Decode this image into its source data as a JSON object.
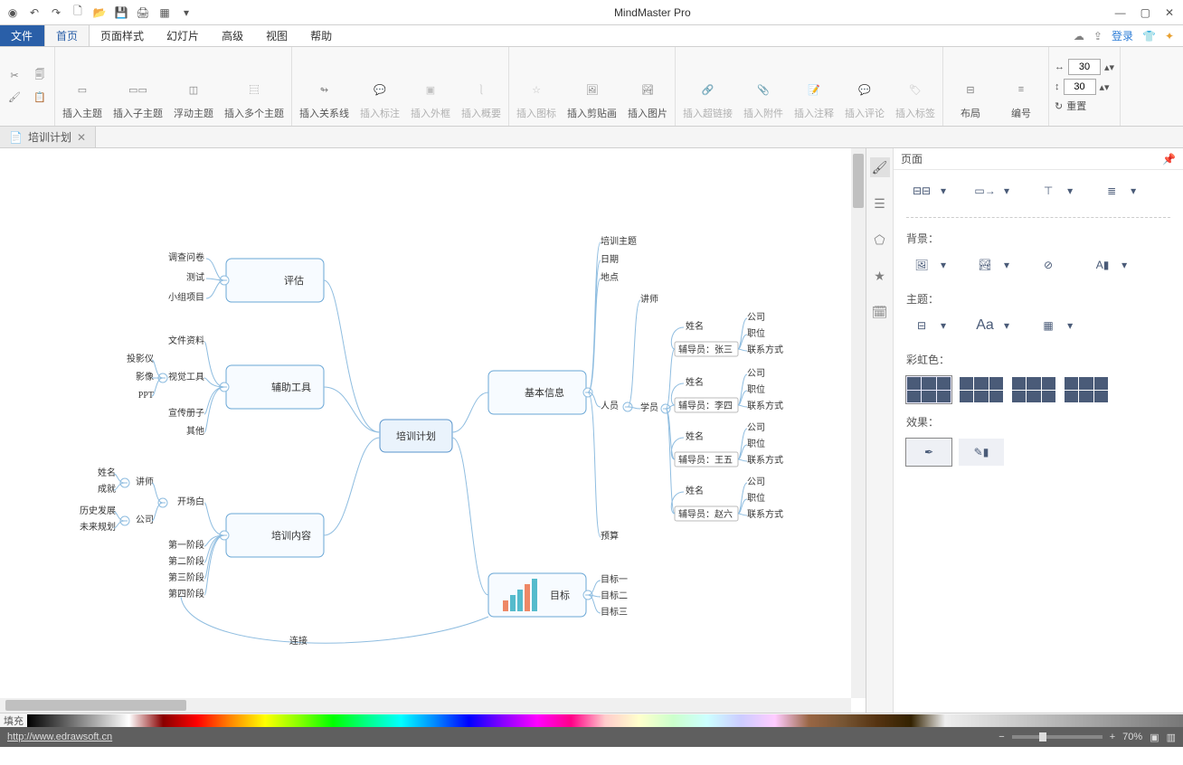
{
  "app": {
    "title": "MindMaster Pro"
  },
  "qat": [
    "target",
    "undo",
    "redo",
    "new",
    "open",
    "save",
    "print",
    "export"
  ],
  "tabs": {
    "file": "文件",
    "items": [
      "首页",
      "页面样式",
      "幻灯片",
      "高级",
      "视图",
      "帮助"
    ],
    "active": 0,
    "login": "登录"
  },
  "ribbon": {
    "insert": [
      "插入主题",
      "插入子主题",
      "浮动主题",
      "插入多个主题"
    ],
    "relation": "插入关系线",
    "dim1": [
      "插入标注",
      "插入外框",
      "插入概要"
    ],
    "dim2": [
      "插入图标"
    ],
    "media": [
      "插入剪贴画",
      "插入图片"
    ],
    "dim3": [
      "插入超链接",
      "插入附件",
      "插入注释",
      "插入评论",
      "插入标签"
    ],
    "layout": "布局",
    "number": "编号",
    "spin1": "30",
    "spin2": "30",
    "reset": "重置"
  },
  "doc_tab": {
    "name": "培训计划"
  },
  "side_panel": {
    "title": "页面",
    "sections": {
      "bg": "背景：",
      "theme": "主题：",
      "rainbow": "彩虹色：",
      "effect": "效果："
    }
  },
  "status": {
    "fill": "填充",
    "url": "http://www.edrawsoft.cn",
    "zoom": "70%"
  },
  "mindmap": {
    "root": "培训计划",
    "left": [
      {
        "label": "评估",
        "children": [
          "调查问卷",
          "测试",
          "小组项目"
        ]
      },
      {
        "label": "辅助工具",
        "children": [
          {
            "label": "文件资料"
          },
          {
            "label": "视觉工具",
            "children": [
              "投影仪",
              "影像",
              "PPT"
            ]
          },
          {
            "label": "宣传册子"
          },
          {
            "label": "其他"
          }
        ]
      },
      {
        "label": "培训内容",
        "children": [
          {
            "label": "开场白",
            "children": [
              {
                "label": "讲师",
                "children": [
                  "姓名",
                  "成就"
                ]
              },
              {
                "label": "公司",
                "children": [
                  "历史发展",
                  "未来规划"
                ]
              }
            ]
          },
          {
            "label": "第一阶段"
          },
          {
            "label": "第二阶段"
          },
          {
            "label": "第三阶段"
          },
          {
            "label": "第四阶段"
          }
        ]
      }
    ],
    "right": [
      {
        "label": "基本信息",
        "children": [
          {
            "label": "培训主题"
          },
          {
            "label": "日期"
          },
          {
            "label": "地点"
          },
          {
            "label": "人员",
            "children": [
              {
                "label": "讲师"
              },
              {
                "label": "学员",
                "children": [
                  {
                    "label": "辅导员：张三",
                    "sub": [
                      "姓名",
                      "公司",
                      "职位",
                      "联系方式"
                    ]
                  },
                  {
                    "label": "辅导员：李四",
                    "sub": [
                      "姓名",
                      "公司",
                      "职位",
                      "联系方式"
                    ]
                  },
                  {
                    "label": "辅导员：王五",
                    "sub": [
                      "姓名",
                      "公司",
                      "职位",
                      "联系方式"
                    ]
                  },
                  {
                    "label": "辅导员：赵六",
                    "sub": [
                      "姓名",
                      "公司",
                      "职位",
                      "联系方式"
                    ]
                  }
                ]
              }
            ]
          },
          {
            "label": "预算"
          }
        ]
      },
      {
        "label": "目标",
        "children": [
          "目标一",
          "目标二",
          "目标三"
        ]
      }
    ],
    "connection": "连接"
  }
}
